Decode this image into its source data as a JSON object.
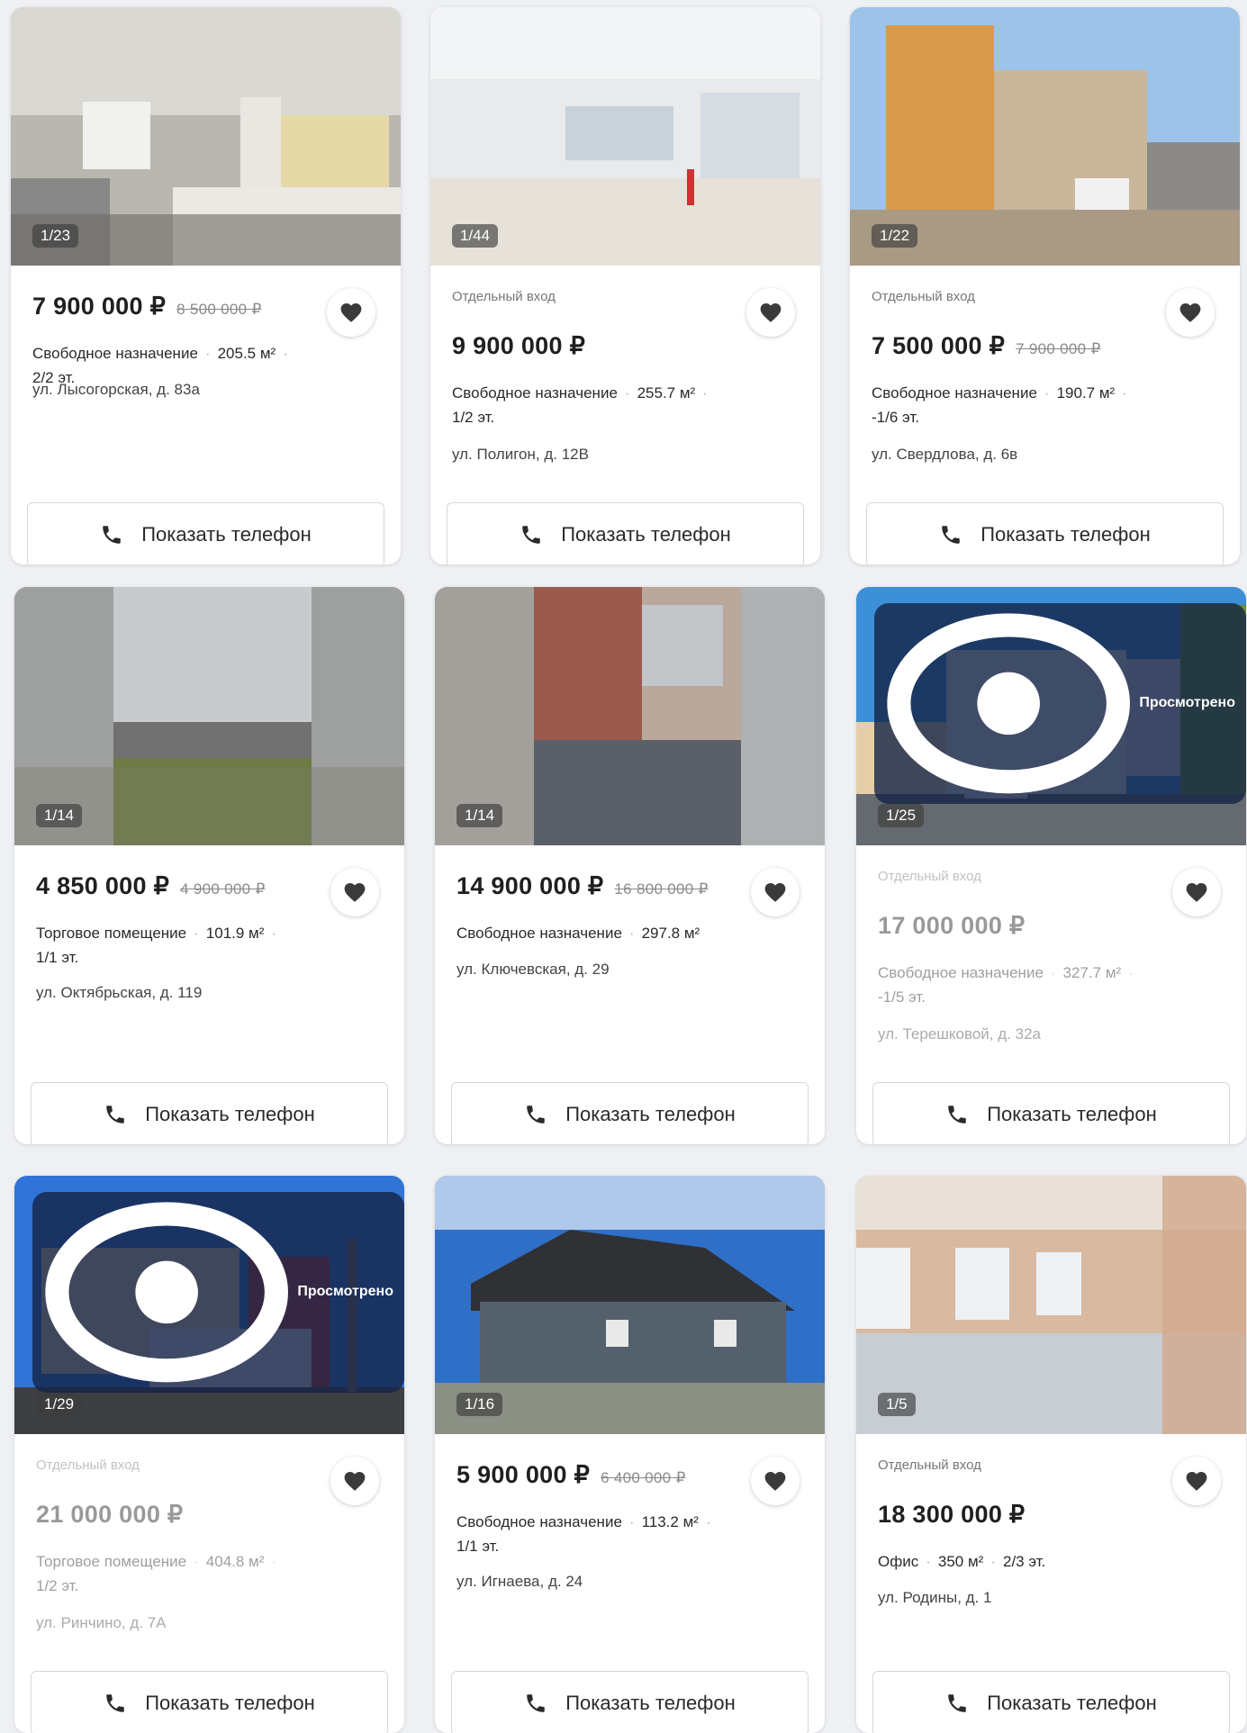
{
  "phone_label": "Показать телефон",
  "viewed_label": "Просмотрено",
  "listings": [
    {
      "counter": "1/23",
      "tag": "",
      "price": "7 900 000 ₽",
      "old_price": "8 500 000 ₽",
      "type": "Свободное назначение",
      "area": "205.5 м²",
      "floor": "2/2 эт.",
      "address": "ул. Лысогорская, д. 83а",
      "viewed": false
    },
    {
      "counter": "1/44",
      "tag": "Отдельный вход",
      "price": "9 900 000 ₽",
      "old_price": "",
      "type": "Свободное назначение",
      "area": "255.7 м²",
      "floor": "1/2 эт.",
      "address": "ул. Полигон, д. 12В",
      "viewed": false
    },
    {
      "counter": "1/22",
      "tag": "Отдельный вход",
      "price": "7 500 000 ₽",
      "old_price": "7 900 000 ₽",
      "type": "Свободное назначение",
      "area": "190.7 м²",
      "floor": "-1/6 эт.",
      "address": "ул. Свердлова, д. 6в",
      "viewed": false
    },
    {
      "counter": "1/14",
      "tag": "",
      "price": "4 850 000 ₽",
      "old_price": "4 900 000 ₽",
      "type": "Торговое помещение",
      "area": "101.9 м²",
      "floor": "1/1 эт.",
      "address": "ул. Октябрьская, д. 119",
      "viewed": false
    },
    {
      "counter": "1/14",
      "tag": "",
      "price": "14 900 000 ₽",
      "old_price": "16 800 000 ₽",
      "type": "Свободное назначение",
      "area": "297.8 м²",
      "floor": "",
      "address": "ул. Ключевская, д. 29",
      "viewed": false
    },
    {
      "counter": "1/25",
      "tag": "Отдельный вход",
      "price": "17 000 000 ₽",
      "old_price": "",
      "type": "Свободное назначение",
      "area": "327.7 м²",
      "floor": "-1/5 эт.",
      "address": "ул. Терешковой, д. 32а",
      "viewed": true
    },
    {
      "counter": "1/29",
      "tag": "Отдельный вход",
      "price": "21 000 000 ₽",
      "old_price": "",
      "type": "Торговое помещение",
      "area": "404.8 м²",
      "floor": "1/2 эт.",
      "address": "ул. Ринчино, д. 7А",
      "viewed": true
    },
    {
      "counter": "1/16",
      "tag": "",
      "price": "5 900 000 ₽",
      "old_price": "6 400 000 ₽",
      "type": "Свободное назначение",
      "area": "113.2 м²",
      "floor": "1/1 эт.",
      "address": "ул. Игнаева, д. 24",
      "viewed": false
    },
    {
      "counter": "1/5",
      "tag": "Отдельный вход",
      "price": "18 300 000 ₽",
      "old_price": "",
      "type": "Офис",
      "area": "350 м²",
      "floor": "2/3 эт.",
      "address": "ул. Родины, д. 1",
      "viewed": false
    }
  ]
}
